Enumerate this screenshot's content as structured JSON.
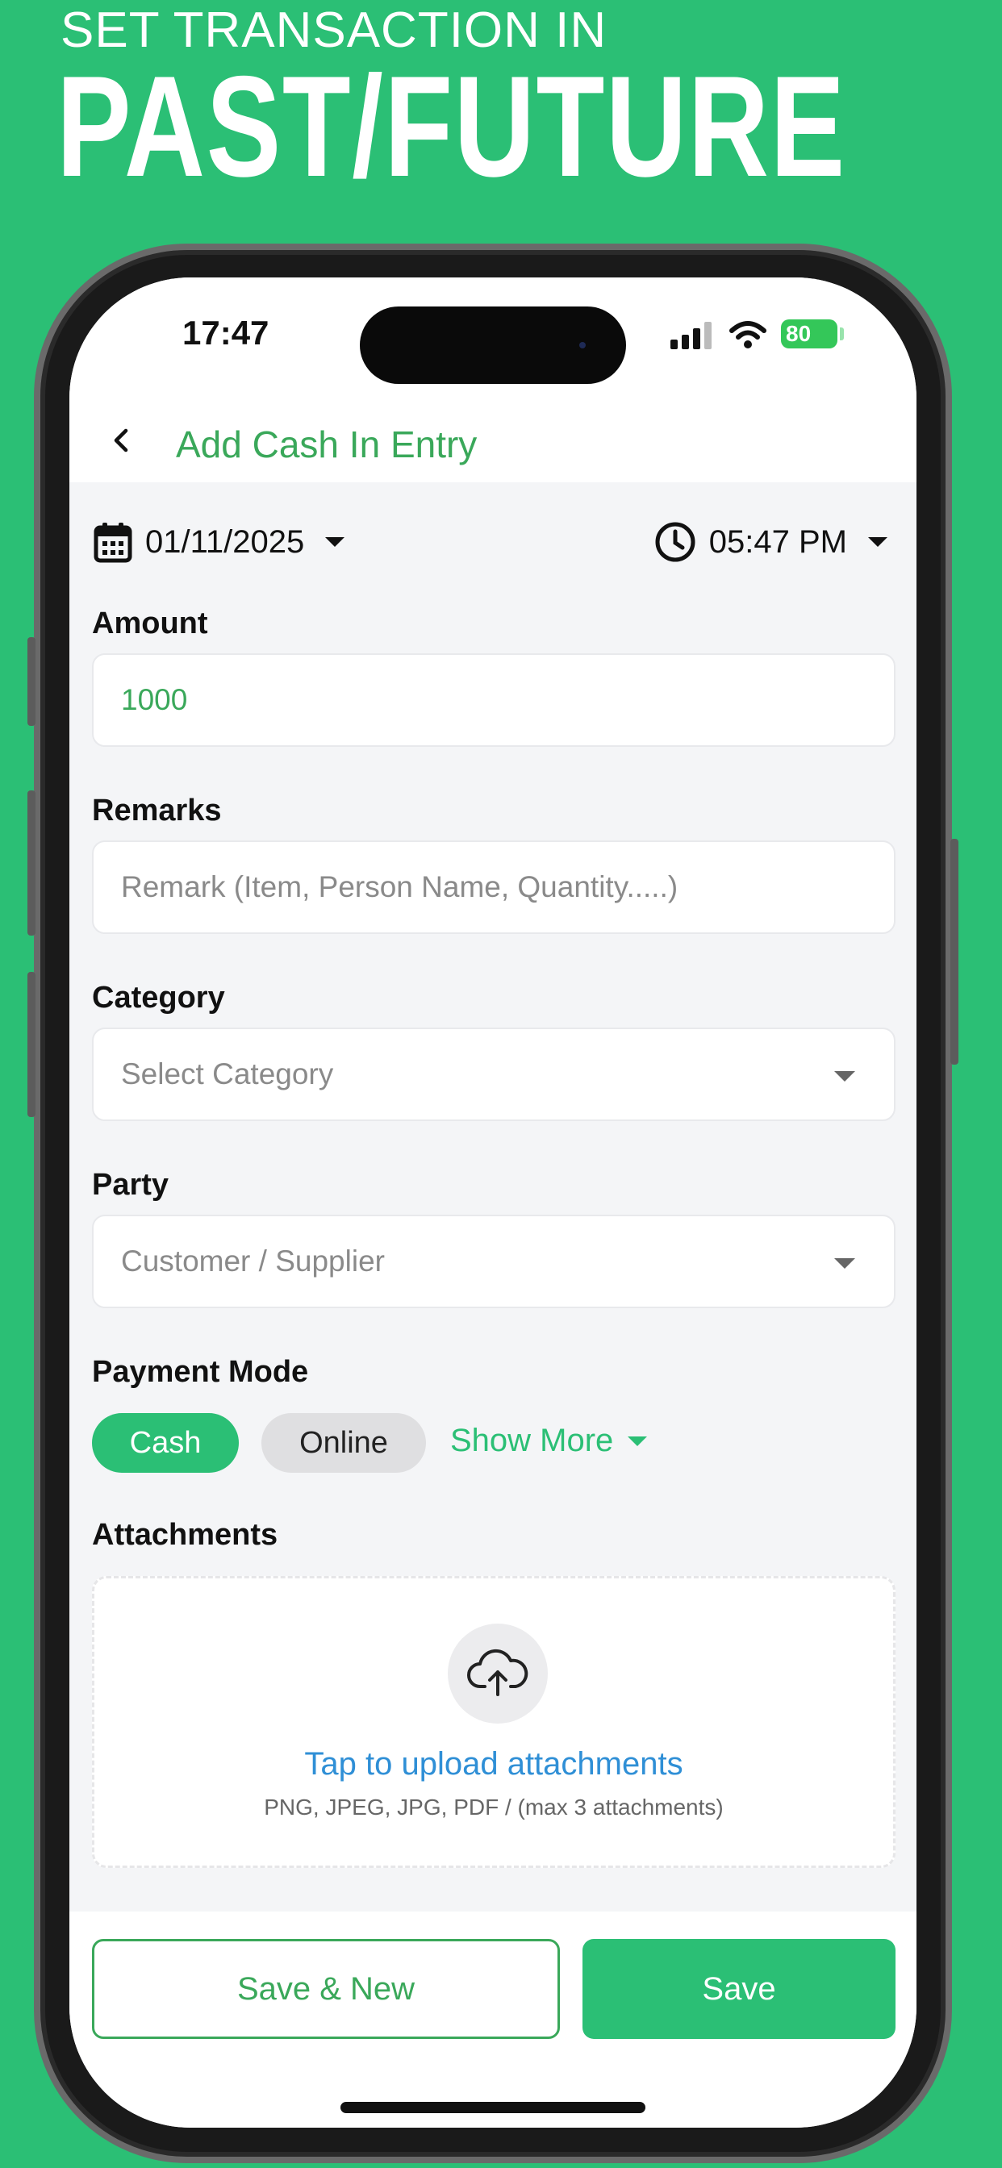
{
  "banner": {
    "line1": "SET TRANSACTION IN",
    "line2": "PAST/FUTURE"
  },
  "status_bar": {
    "time": "17:47",
    "battery": "80"
  },
  "header": {
    "title": "Add Cash In Entry",
    "back_icon": "chevron-left-icon"
  },
  "date_time": {
    "date": "01/11/2025",
    "time": "05:47 PM",
    "date_icon": "calendar-icon",
    "time_icon": "clock-icon"
  },
  "amount": {
    "label": "Amount",
    "value": "1000"
  },
  "remarks": {
    "label": "Remarks",
    "placeholder": "Remark (Item, Person Name, Quantity.....)"
  },
  "category": {
    "label": "Category",
    "placeholder": "Select Category"
  },
  "party": {
    "label": "Party",
    "placeholder": "Customer / Supplier"
  },
  "payment_mode": {
    "label": "Payment Mode",
    "options": [
      "Cash",
      "Online"
    ],
    "selected": "Cash",
    "show_more": "Show More"
  },
  "attachments": {
    "label": "Attachments",
    "upload_title": "Tap to upload attachments",
    "upload_hint": "PNG, JPEG, JPG, PDF / (max 3 attachments)",
    "icon": "cloud-upload-icon"
  },
  "actions": {
    "save_new": "Save & New",
    "save": "Save"
  },
  "colors": {
    "brand_green": "#2bbf75",
    "title_green": "#3aa85a",
    "link_blue": "#2f8fd6"
  }
}
